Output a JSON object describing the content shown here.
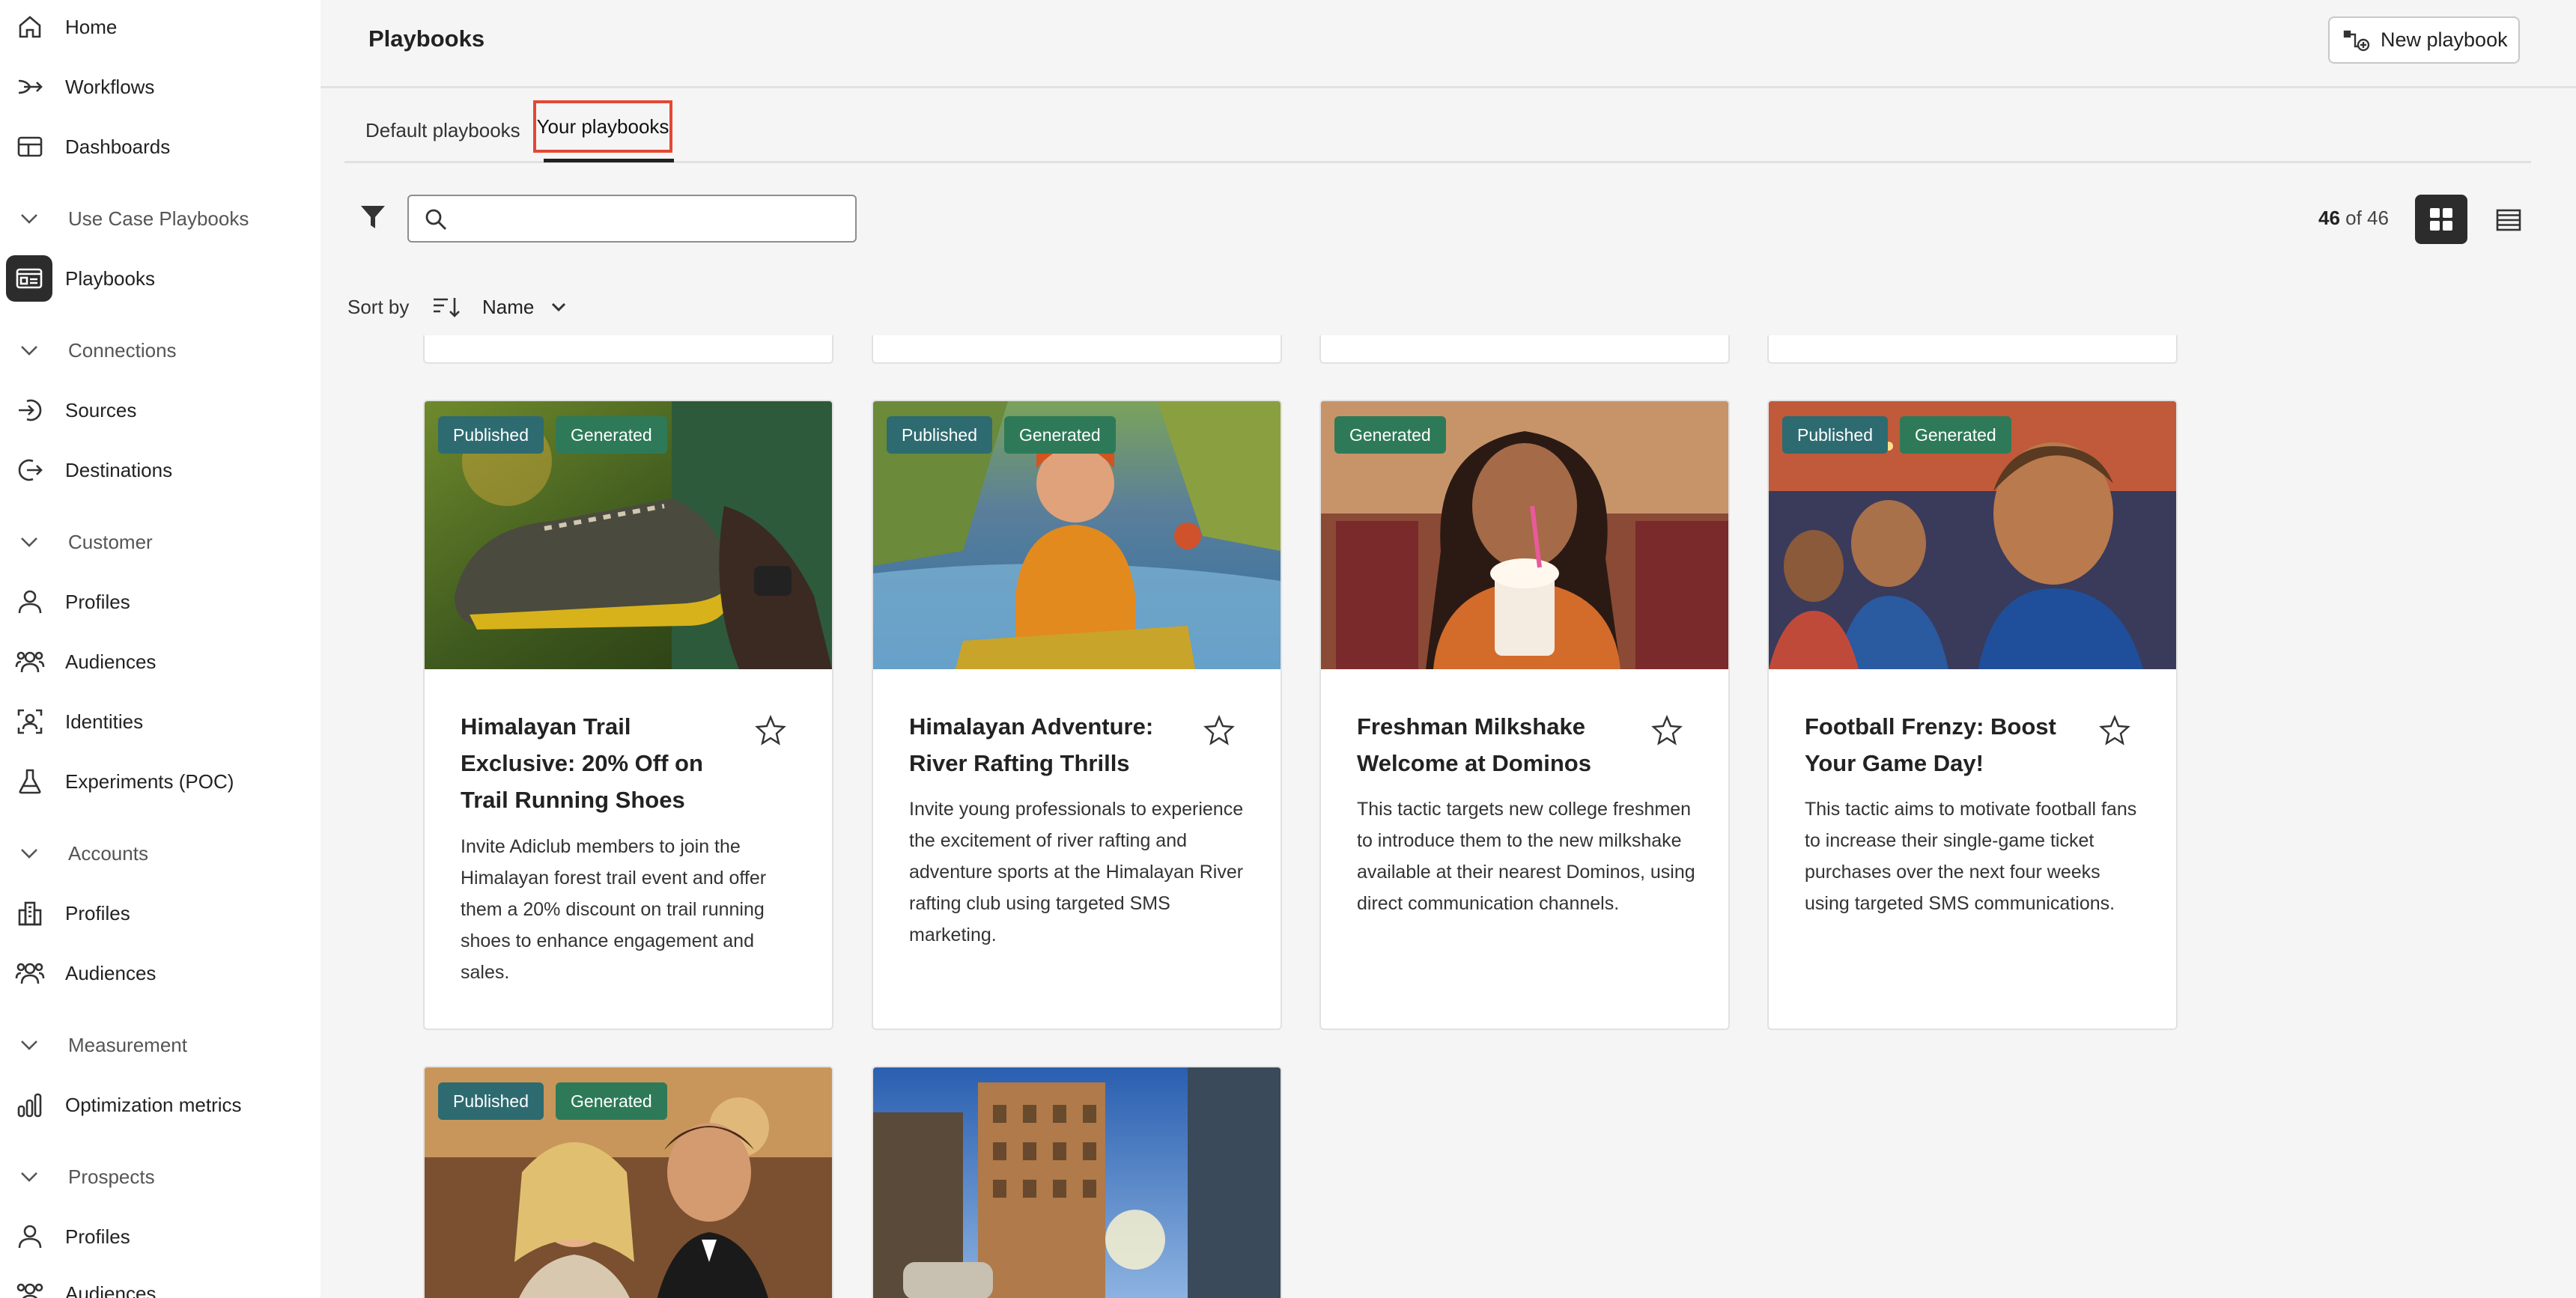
{
  "sidebar": {
    "items": [
      {
        "label": "Home",
        "icon": "home-icon"
      },
      {
        "label": "Workflows",
        "icon": "workflow-icon"
      },
      {
        "label": "Dashboards",
        "icon": "dashboard-icon"
      },
      {
        "section": "Use Case Playbooks"
      },
      {
        "label": "Playbooks",
        "icon": "playbook-icon",
        "active": true
      },
      {
        "section": "Connections"
      },
      {
        "label": "Sources",
        "icon": "source-icon"
      },
      {
        "label": "Destinations",
        "icon": "destination-icon"
      },
      {
        "section": "Customer"
      },
      {
        "label": "Profiles",
        "icon": "profile-icon"
      },
      {
        "label": "Audiences",
        "icon": "audiences-icon"
      },
      {
        "label": "Identities",
        "icon": "identity-icon"
      },
      {
        "label": "Experiments (POC)",
        "icon": "flask-icon"
      },
      {
        "section": "Accounts"
      },
      {
        "label": "Profiles",
        "icon": "building-icon"
      },
      {
        "label": "Audiences",
        "icon": "audiences-icon"
      },
      {
        "section": "Measurement"
      },
      {
        "label": "Optimization metrics",
        "icon": "metrics-icon"
      },
      {
        "section": "Prospects"
      },
      {
        "label": "Profiles",
        "icon": "profile-icon"
      },
      {
        "label": "Audiences",
        "icon": "audiences-icon"
      }
    ]
  },
  "header": {
    "title": "Playbooks",
    "new_button_label": "New playbook"
  },
  "tabs": [
    {
      "label": "Default playbooks"
    },
    {
      "label": "Your playbooks",
      "selected": true
    }
  ],
  "search": {
    "placeholder": "",
    "value": ""
  },
  "results": {
    "shown": "46",
    "total_text": " of 46"
  },
  "sort": {
    "label": "Sort by",
    "value": "Name"
  },
  "badge_labels": {
    "published": "Published",
    "generated": "Generated"
  },
  "cards": [
    {
      "title": "Himalayan Trail Exclusive: 20% Off on Trail Running Shoes",
      "description": "Invite Adiclub members to join the Himalayan forest trail event and offer them a 20% discount on trail running shoes to enhance engagement and sales.",
      "published": true,
      "generated": true
    },
    {
      "title": "Himalayan Adventure: River Rafting Thrills",
      "description": "Invite young professionals to experience the excitement of river rafting and adventure sports at the Himalayan River rafting club using targeted SMS marketing.",
      "published": true,
      "generated": true
    },
    {
      "title": "Freshman Milkshake Welcome at Dominos",
      "description": "This tactic targets new college freshmen to introduce them to the new milkshake available at their nearest Dominos, using direct communication channels.",
      "published": false,
      "generated": true
    },
    {
      "title": "Football Frenzy: Boost Your Game Day!",
      "description": "This tactic aims to motivate football fans to increase their single-game ticket purchases over the next four weeks using targeted SMS communications.",
      "published": true,
      "generated": true
    },
    {
      "published": true,
      "generated": true
    },
    {
      "published": false,
      "generated": false
    }
  ],
  "colors": {
    "accent_dark": "#2c2c2c",
    "badge_published": "#2d6b71",
    "badge_generated": "#2e7a58",
    "tab_highlight": "#e34834"
  }
}
